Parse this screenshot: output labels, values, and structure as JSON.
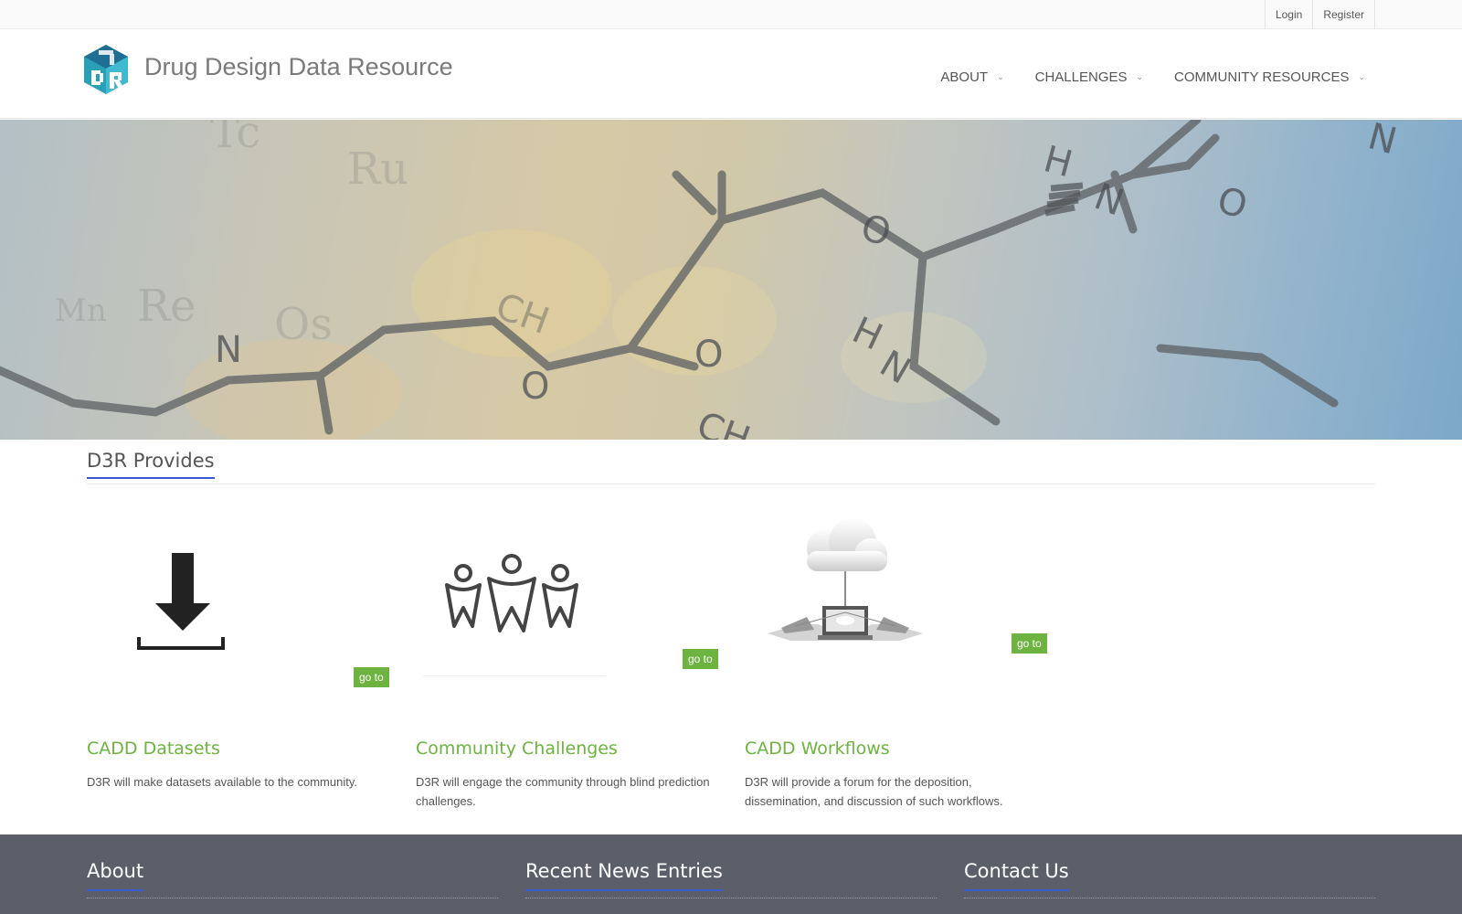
{
  "topbar": {
    "login": "Login",
    "register": "Register"
  },
  "header": {
    "site_title": "Drug Design Data Resource",
    "nav": [
      {
        "label": "ABOUT"
      },
      {
        "label": "CHALLENGES"
      },
      {
        "label": "COMMUNITY RESOURCES"
      }
    ]
  },
  "provides": {
    "heading": "D3R Provides",
    "features": [
      {
        "title": "CADD Datasets",
        "description": "D3R will make datasets available to the community.",
        "button": "go to",
        "icon": "download-icon"
      },
      {
        "title": "Community Challenges",
        "description": "D3R will engage the community through blind prediction challenges.",
        "button": "go to",
        "icon": "people-icon"
      },
      {
        "title": "CADD Workflows",
        "description": "D3R will provide a forum for the deposition, dissemination, and discussion of such workflows.",
        "button": "go to",
        "icon": "cloud-network-icon"
      }
    ]
  },
  "footer": {
    "about": "About",
    "news": "Recent News Entries",
    "contact": "Contact Us"
  },
  "colors": {
    "accent_green": "#6db33f",
    "accent_blue": "#3a5bd0",
    "footer_bg": "#5a5f6a"
  }
}
